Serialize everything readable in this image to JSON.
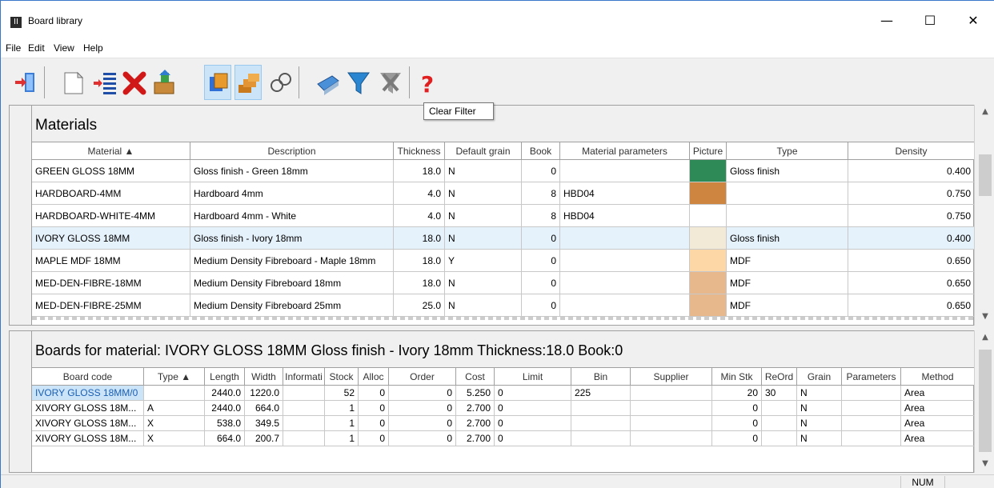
{
  "window": {
    "title": "Board library",
    "app_icon": "II",
    "minimize": "—",
    "maximize": "☐",
    "close": "✕"
  },
  "menu": [
    "File",
    "Edit",
    "View",
    "Help"
  ],
  "toolbar": {
    "tooltip": "Clear Filter",
    "icons": [
      "exit-icon",
      "new-icon",
      "insert-icon",
      "delete-icon",
      "import-icon",
      "boards-icon",
      "parts-icon",
      "find-icon",
      "print-icon",
      "filter-icon",
      "clear-filter-icon",
      "help-icon"
    ]
  },
  "materials": {
    "title": "Materials",
    "columns": [
      "Material",
      "Description",
      "Thickness",
      "Default grain",
      "Book",
      "Material parameters",
      "Picture",
      "Type",
      "Density"
    ],
    "sort_indicator": "▲",
    "rows": [
      {
        "material": "GREEN GLOSS 18MM",
        "description": "Gloss finish - Green 18mm",
        "thickness": "18.0",
        "grain": "N",
        "book": "0",
        "params": "",
        "color": "#2e8b57",
        "type": "Gloss finish",
        "density": "0.400"
      },
      {
        "material": "HARDBOARD-4MM",
        "description": "Hardboard 4mm",
        "thickness": "4.0",
        "grain": "N",
        "book": "8",
        "params": "HBD04",
        "color": "#cd853f",
        "type": "",
        "density": "0.750"
      },
      {
        "material": "HARDBOARD-WHITE-4MM",
        "description": "Hardboard 4mm - White",
        "thickness": "4.0",
        "grain": "N",
        "book": "8",
        "params": "HBD04",
        "color": "#ffffff",
        "type": "",
        "density": "0.750"
      },
      {
        "material": "IVORY GLOSS 18MM",
        "description": "Gloss finish - Ivory 18mm",
        "thickness": "18.0",
        "grain": "N",
        "book": "0",
        "params": "",
        "color": "#f2ead6",
        "type": "Gloss finish",
        "density": "0.400"
      },
      {
        "material": "MAPLE MDF 18MM",
        "description": "Medium Density Fibreboard - Maple 18mm",
        "thickness": "18.0",
        "grain": "Y",
        "book": "0",
        "params": "",
        "color": "#fed7a6",
        "type": "MDF",
        "density": "0.650"
      },
      {
        "material": "MED-DEN-FIBRE-18MM",
        "description": "Medium Density Fibreboard 18mm",
        "thickness": "18.0",
        "grain": "N",
        "book": "0",
        "params": "",
        "color": "#e6b88c",
        "type": "MDF",
        "density": "0.650"
      },
      {
        "material": "MED-DEN-FIBRE-25MM",
        "description": "Medium Density Fibreboard 25mm",
        "thickness": "25.0",
        "grain": "N",
        "book": "0",
        "params": "",
        "color": "#e6b88c",
        "type": "MDF",
        "density": "0.650"
      }
    ]
  },
  "boards": {
    "title": "Boards for material: IVORY GLOSS 18MM Gloss finish - Ivory 18mm Thickness:18.0 Book:0",
    "columns": [
      "Board code",
      "Type",
      "Length",
      "Width",
      "Informati",
      "Stock",
      "Alloc",
      "Order",
      "Cost",
      "Limit",
      "Bin",
      "Supplier",
      "Min Stk",
      "ReOrd",
      "Grain",
      "Parameters",
      "Method"
    ],
    "sort_indicator": "▲",
    "rows": [
      {
        "code": "IVORY GLOSS 18MM/0",
        "type": "",
        "length": "2440.0",
        "width": "1220.0",
        "info": "",
        "stock": "52",
        "alloc": "0",
        "order": "0",
        "cost": "5.250",
        "limit": "0",
        "bin": "225",
        "supplier": "",
        "minstk": "20",
        "reord": "30",
        "grain": "N",
        "params": "",
        "method": "Area"
      },
      {
        "code": "XIVORY GLOSS 18M...",
        "type": "A",
        "length": "2440.0",
        "width": "664.0",
        "info": "",
        "stock": "1",
        "alloc": "0",
        "order": "0",
        "cost": "2.700",
        "limit": "0",
        "bin": "",
        "supplier": "",
        "minstk": "0",
        "reord": "",
        "grain": "N",
        "params": "",
        "method": "Area"
      },
      {
        "code": "XIVORY GLOSS 18M...",
        "type": "X",
        "length": "538.0",
        "width": "349.5",
        "info": "",
        "stock": "1",
        "alloc": "0",
        "order": "0",
        "cost": "2.700",
        "limit": "0",
        "bin": "",
        "supplier": "",
        "minstk": "0",
        "reord": "",
        "grain": "N",
        "params": "",
        "method": "Area"
      },
      {
        "code": "XIVORY GLOSS 18M...",
        "type": "X",
        "length": "664.0",
        "width": "200.7",
        "info": "",
        "stock": "1",
        "alloc": "0",
        "order": "0",
        "cost": "2.700",
        "limit": "0",
        "bin": "",
        "supplier": "",
        "minstk": "0",
        "reord": "",
        "grain": "N",
        "params": "",
        "method": "Area"
      }
    ]
  },
  "status": {
    "num": "NUM"
  }
}
